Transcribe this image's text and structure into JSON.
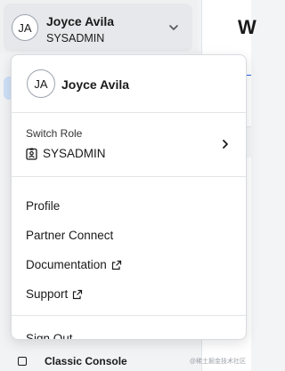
{
  "user": {
    "initials": "JA",
    "name": "Joyce Avila",
    "role": "SYSADMIN"
  },
  "background": {
    "title_fragment": "W",
    "bottom_item": "Classic Console"
  },
  "menu": {
    "header": {
      "initials": "JA",
      "name": "Joyce Avila"
    },
    "switch_role": {
      "label": "Switch Role",
      "current_role": "SYSADMIN"
    },
    "items": [
      {
        "label": "Profile",
        "external": false
      },
      {
        "label": "Partner Connect",
        "external": false
      },
      {
        "label": "Documentation",
        "external": true
      },
      {
        "label": "Support",
        "external": true
      }
    ],
    "sign_out": "Sign Out"
  },
  "watermark": "@稀土掘金技术社区",
  "colors": {
    "accent": "#2563eb",
    "menu_bg": "#ffffff",
    "user_button_bg": "#e6e8eb"
  }
}
